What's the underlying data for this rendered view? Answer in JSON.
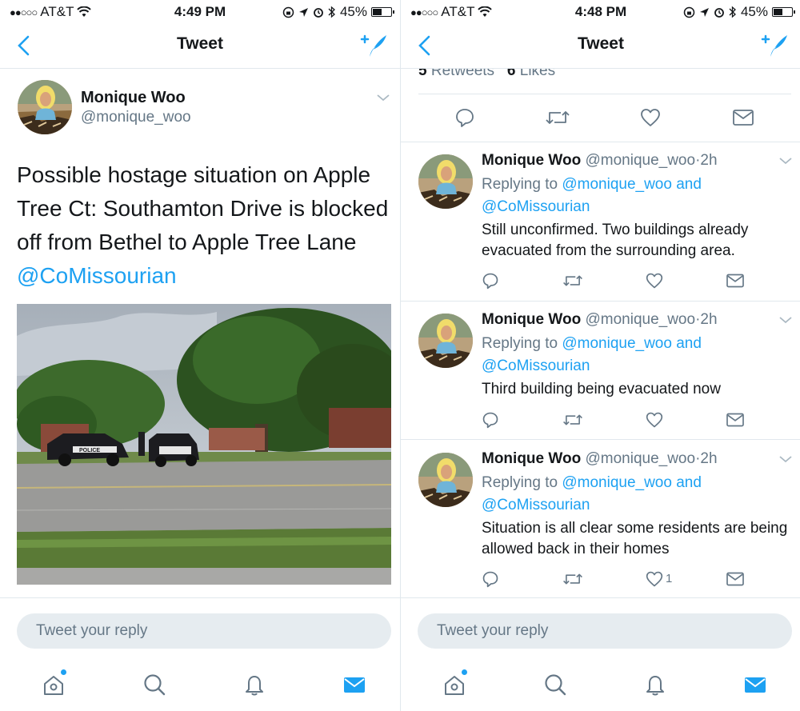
{
  "left": {
    "status": {
      "carrier": "AT&T",
      "signal": "●●○○○",
      "time": "4:49 PM",
      "battery": "45%",
      "battery_level": 0.45
    },
    "nav": {
      "title": "Tweet",
      "back_icon": "chevron-left-icon",
      "compose_icon": "compose-tweet-icon"
    },
    "tweet": {
      "name": "Monique Woo",
      "handle": "@monique_woo",
      "text": "Possible hostage situation on Apple Tree Ct: Southamton Drive is blocked off from Bethel to Apple Tree Lane",
      "mention": "@CoMissourian",
      "photo_label": "POLICE"
    },
    "reply": {
      "placeholder": "Tweet your reply"
    }
  },
  "right": {
    "status": {
      "carrier": "AT&T",
      "signal": "●●○○○",
      "time": "4:48 PM",
      "battery": "45%",
      "battery_level": 0.45
    },
    "nav": {
      "title": "Tweet"
    },
    "stats": {
      "retweets_count": "5",
      "retweets_label": "Retweets",
      "likes_count": "6",
      "likes_label": "Likes"
    },
    "replies": [
      {
        "name": "Monique Woo",
        "handle": "@monique_woo",
        "dot": "·",
        "time": "2h",
        "replying_prefix": "Replying to",
        "replying_to": "@monique_woo and",
        "replying_to2": "@CoMissourian",
        "text": "Still unconfirmed. Two buildings already evacuated from the surrounding area.",
        "like_count": ""
      },
      {
        "name": "Monique Woo",
        "handle": "@monique_woo",
        "dot": "·",
        "time": "2h",
        "replying_prefix": "Replying to",
        "replying_to": "@monique_woo and",
        "replying_to2": "@CoMissourian",
        "text": "Third building being evacuated now",
        "like_count": ""
      },
      {
        "name": "Monique Woo",
        "handle": "@monique_woo",
        "dot": "·",
        "time": "2h",
        "replying_prefix": "Replying to",
        "replying_to": "@monique_woo and",
        "replying_to2": "@CoMissourian",
        "text": "Situation is all clear some residents are being  allowed back in their homes",
        "like_count": "1"
      }
    ],
    "reply": {
      "placeholder": "Tweet your reply"
    }
  },
  "tabbar": {
    "items": [
      "home-icon",
      "search-icon",
      "notifications-icon",
      "messages-icon"
    ]
  },
  "colors": {
    "accent": "#1da1f2",
    "secondary_text": "#657786",
    "divider": "#e1e8ed",
    "input_bg": "#e6ecf0"
  }
}
